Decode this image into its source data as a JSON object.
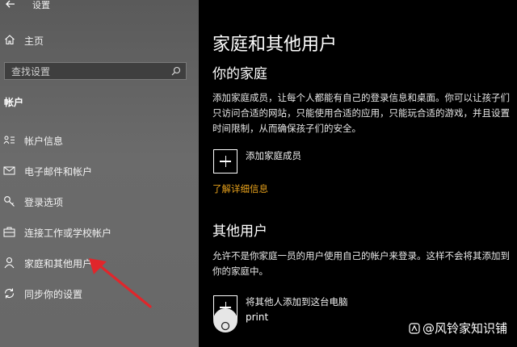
{
  "window": {
    "title": "设置"
  },
  "sidebar": {
    "home_label": "主页",
    "search_placeholder": "查找设置",
    "section_heading": "帐户",
    "items": [
      {
        "label": "帐户信息",
        "icon": "account-info-icon"
      },
      {
        "label": "电子邮件和帐户",
        "icon": "mail-icon"
      },
      {
        "label": "登录选项",
        "icon": "key-icon"
      },
      {
        "label": "连接工作或学校帐户",
        "icon": "briefcase-icon"
      },
      {
        "label": "家庭和其他用户",
        "icon": "person-icon"
      },
      {
        "label": "同步你的设置",
        "icon": "sync-icon"
      }
    ]
  },
  "main": {
    "title": "家庭和其他用户",
    "family": {
      "heading": "你的家庭",
      "description": "添加家庭成员，让每个人都能有自己的登录信息和桌面。你可以让孩子们只访问合适的网站，只能使用合适的应用，只能玩合适的游戏，并且设置时间限制，从而确保孩子们的安全。",
      "add_label": "添加家庭成员",
      "learn_more": "了解详细信息"
    },
    "others": {
      "heading": "其他用户",
      "description": "允许不是你家庭一员的用户使用自己的帐户来登录。这样不会将其添加到你的家庭中。",
      "add_label": "将其他人添加到这台电脑",
      "user_name": "print"
    }
  },
  "watermark": "@风铃家知识铺",
  "colors": {
    "link": "#e8a21c",
    "arrow": "#e0262b",
    "sidebar_bg": "#646464",
    "main_bg": "#000000"
  }
}
